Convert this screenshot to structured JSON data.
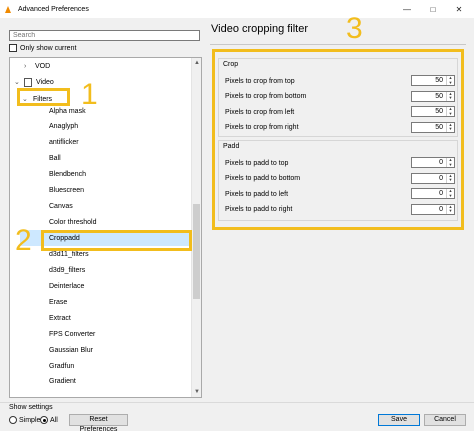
{
  "window": {
    "title": "Advanced Preferences",
    "minimize": "—",
    "maximize": "□",
    "close": "✕"
  },
  "search": {
    "placeholder": "Search"
  },
  "only_show_current_label": "Only show current",
  "tree": {
    "top_items": [
      {
        "label": "VOD",
        "expander": ">"
      },
      {
        "label": "Video",
        "expander": "v"
      },
      {
        "label": "Filters",
        "expander": "v"
      }
    ],
    "filter_items": [
      "Alpha mask",
      "Anaglyph",
      "antiflicker",
      "Ball",
      "Blendbench",
      "Bluescreen",
      "Canvas",
      "Color threshold",
      "Croppadd",
      "d3d11_filters",
      "d3d9_filters",
      "Deinterlace",
      "Erase",
      "Extract",
      "FPS Converter",
      "Gaussian Blur",
      "Gradfun",
      "Gradient"
    ],
    "selected": "Croppadd"
  },
  "panel": {
    "title": "Video cropping filter",
    "crop": {
      "group_label": "Crop",
      "fields": [
        {
          "label": "Pixels to crop from top",
          "value": "50"
        },
        {
          "label": "Pixels to crop from bottom",
          "value": "50"
        },
        {
          "label": "Pixels to crop from left",
          "value": "50"
        },
        {
          "label": "Pixels to crop from right",
          "value": "50"
        }
      ]
    },
    "padd": {
      "group_label": "Padd",
      "fields": [
        {
          "label": "Pixels to padd to top",
          "value": "0"
        },
        {
          "label": "Pixels to padd to bottom",
          "value": "0"
        },
        {
          "label": "Pixels to padd to left",
          "value": "0"
        },
        {
          "label": "Pixels to padd to right",
          "value": "0"
        }
      ]
    }
  },
  "annotations": {
    "one": "1",
    "two": "2",
    "three": "3",
    "color": "#f2bd1d"
  },
  "footer": {
    "show_settings_label": "Show settings",
    "simple_label": "Simple",
    "all_label": "All",
    "selected_mode": "All",
    "reset_label": "Reset Preferences",
    "save_label": "Save",
    "cancel_label": "Cancel"
  },
  "icons": {
    "app": "vlc-cone-icon",
    "video": "film-icon",
    "spin": "spin-arrows-icon"
  }
}
